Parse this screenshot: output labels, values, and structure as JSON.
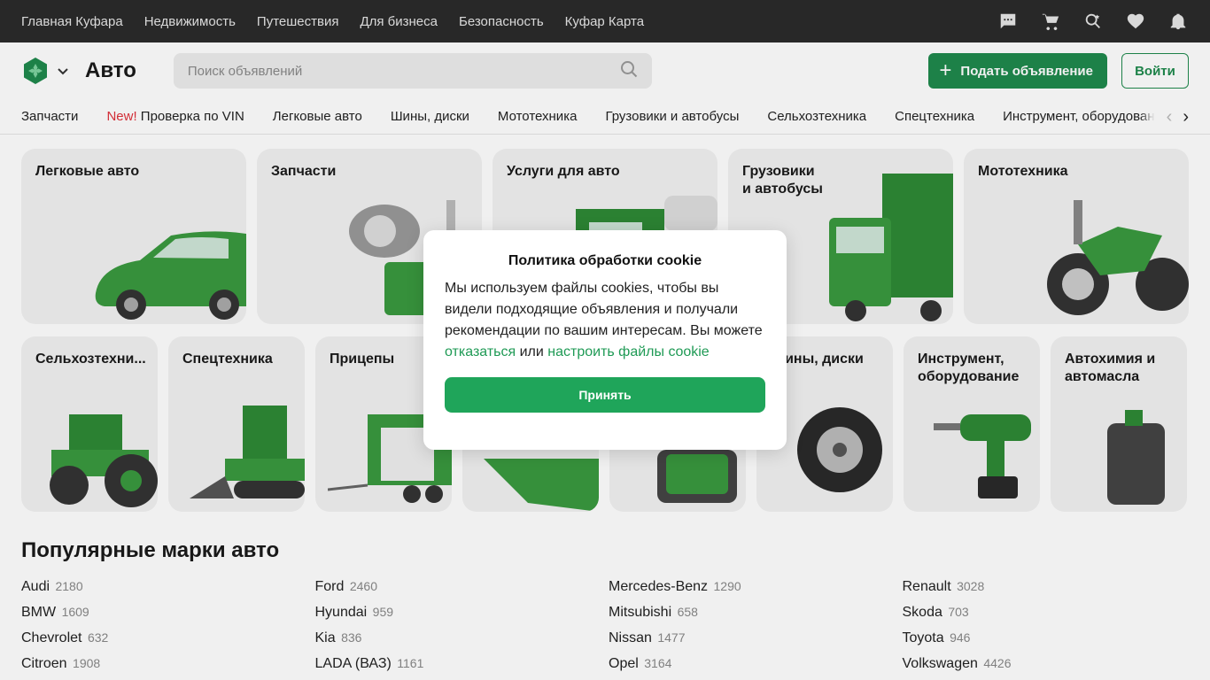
{
  "topbar": {
    "links": [
      "Главная Куфара",
      "Недвижимость",
      "Путешествия",
      "Для бизнеса",
      "Безопасность",
      "Куфар Карта"
    ],
    "icons": [
      "chat-icon",
      "cart-icon",
      "saved-search-icon",
      "heart-icon",
      "bell-icon"
    ]
  },
  "header": {
    "section_title": "Авто",
    "search_placeholder": "Поиск объявлений",
    "post_button": "Подать объявление",
    "login_button": "Войти"
  },
  "catnav": {
    "items": [
      {
        "label": "Запчасти"
      },
      {
        "badge": "New!",
        "label": "Проверка по VIN"
      },
      {
        "label": "Легковые авто"
      },
      {
        "label": "Шины, диски"
      },
      {
        "label": "Мототехника"
      },
      {
        "label": "Грузовики и автобусы"
      },
      {
        "label": "Сельхозтехника"
      },
      {
        "label": "Спецтехника"
      },
      {
        "label": "Инструмент, оборудование"
      }
    ]
  },
  "tiles_row1": [
    {
      "label": "Легковые авто"
    },
    {
      "label": "Запчасти"
    },
    {
      "label": "Услуги для авто"
    },
    {
      "label": "Грузовики\nи автобусы"
    },
    {
      "label": "Мототехника"
    }
  ],
  "tiles_row2": [
    {
      "label": "Сельхозтехни..."
    },
    {
      "label": "Спецтехника"
    },
    {
      "label": "Прицепы"
    },
    {
      "label": ""
    },
    {
      "label": ""
    },
    {
      "label": "Шины, диски"
    },
    {
      "label": "Инструмент,\nоборудование"
    },
    {
      "label": "Автохимия и\nавтомасла"
    }
  ],
  "brands": {
    "title": "Популярные марки авто",
    "columns": [
      [
        {
          "name": "Audi",
          "count": "2180"
        },
        {
          "name": "BMW",
          "count": "1609"
        },
        {
          "name": "Chevrolet",
          "count": "632"
        },
        {
          "name": "Citroen",
          "count": "1908"
        }
      ],
      [
        {
          "name": "Ford",
          "count": "2460"
        },
        {
          "name": "Hyundai",
          "count": "959"
        },
        {
          "name": "Kia",
          "count": "836"
        },
        {
          "name": "LADA (ВАЗ)",
          "count": "1161"
        }
      ],
      [
        {
          "name": "Mercedes-Benz",
          "count": "1290"
        },
        {
          "name": "Mitsubishi",
          "count": "658"
        },
        {
          "name": "Nissan",
          "count": "1477"
        },
        {
          "name": "Opel",
          "count": "3164"
        }
      ],
      [
        {
          "name": "Renault",
          "count": "3028"
        },
        {
          "name": "Skoda",
          "count": "703"
        },
        {
          "name": "Toyota",
          "count": "946"
        },
        {
          "name": "Volkswagen",
          "count": "4426"
        }
      ]
    ]
  },
  "cookie": {
    "title": "Политика обработки cookie",
    "text_before": "Мы используем файлы cookies, чтобы вы видели подходящие объявления и получали рекомендации по вашим интересам. Вы можете ",
    "refuse_link": "отказаться",
    "text_middle": " или ",
    "configure_link": "настроить файлы cookie",
    "accept_button": "Принять"
  },
  "colors": {
    "brand_green": "#1f8a4d",
    "accept_green": "#1fa55a",
    "topbar_bg": "#2b2b2b",
    "new_badge": "#e0313b"
  }
}
